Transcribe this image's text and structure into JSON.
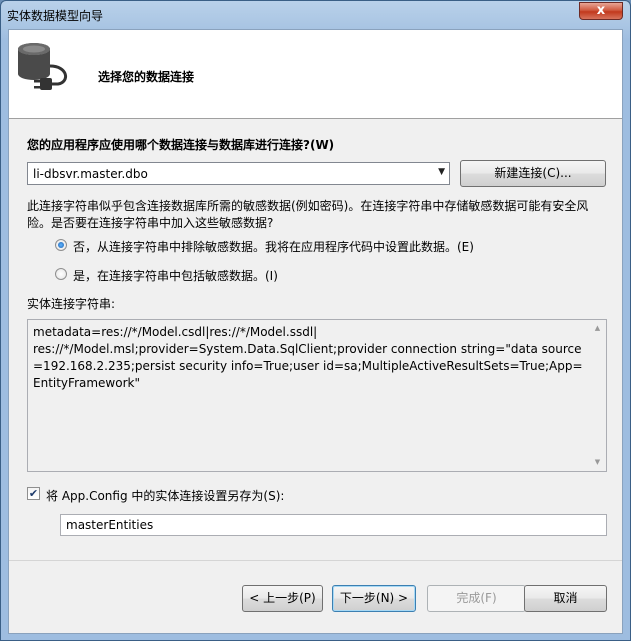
{
  "window": {
    "title": "实体数据模型向导",
    "close_glyph": "x"
  },
  "header": {
    "title": "选择您的数据连接",
    "icon": "database-plug-icon"
  },
  "connection": {
    "question": "您的应用程序应使用哪个数据连接与数据库进行连接?(W)",
    "selected": "li-dbsvr.master.dbo",
    "new_connection_button": "新建连接(C)..."
  },
  "sensitive": {
    "warning": "此连接字符串似乎包含连接数据库所需的敏感数据(例如密码)。在连接字符串中存储敏感数据可能有安全风险。是否要在连接字符串中加入这些敏感数据?",
    "option_no": "否，从连接字符串中排除敏感数据。我将在应用程序代码中设置此数据。(E)",
    "option_yes": "是，在连接字符串中包括敏感数据。(I)",
    "selected_option": "no"
  },
  "entity_connection": {
    "label": "实体连接字符串:",
    "value": "metadata=res://*/Model.csdl|res://*/Model.ssdl|\nres://*/Model.msl;provider=System.Data.SqlClient;provider connection string=\"data source=192.168.2.235;persist security info=True;user id=sa;MultipleActiveResultSets=True;App=EntityFramework\""
  },
  "save_config": {
    "checked": true,
    "label": "将 App.Config 中的实体连接设置另存为(S):",
    "name": "masterEntities"
  },
  "footer": {
    "back": "< 上一步(P)",
    "next": "下一步(N) >",
    "finish": "完成(F)",
    "cancel": "取消"
  },
  "colors": {
    "title_bar": "#a9c5e3",
    "close_button": "#c2391d",
    "client_bg": "#f0f0f0"
  }
}
